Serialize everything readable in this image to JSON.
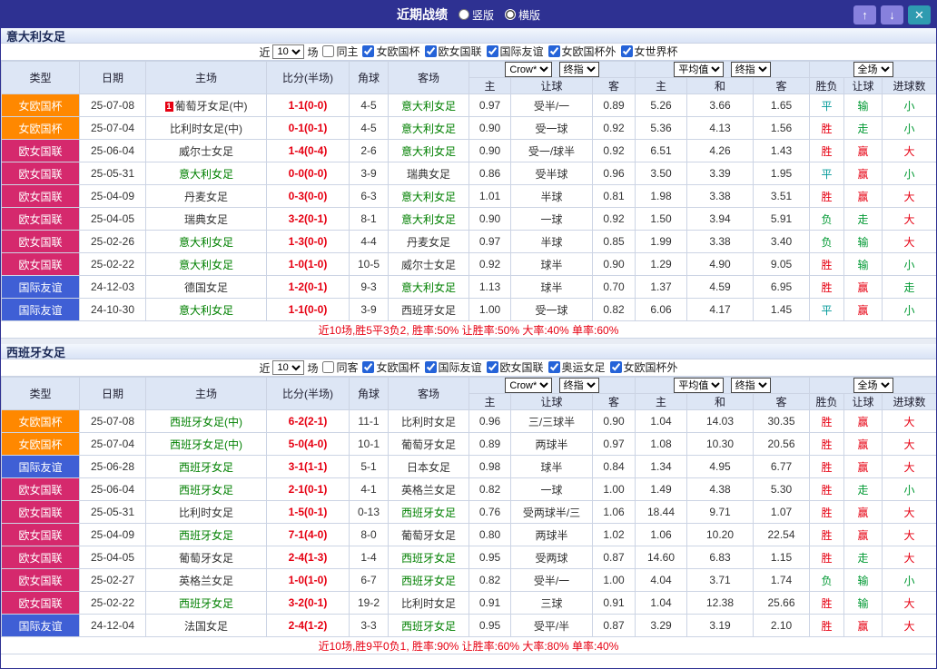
{
  "titlebar": {
    "title": "近期战绩",
    "layout_options": [
      {
        "label": "竖版",
        "checked": false
      },
      {
        "label": "横版",
        "checked": true
      }
    ],
    "buttons": {
      "up": "↑",
      "down": "↓",
      "close": "✕"
    }
  },
  "filter": {
    "prefix": "近",
    "count": "10",
    "suffix": "场"
  },
  "header": {
    "col_type": "类型",
    "col_date": "日期",
    "col_home": "主场",
    "col_score": "比分(半场)",
    "col_corner": "角球",
    "col_away": "客场",
    "dd_company": "Crow*",
    "dd_final": "终指",
    "dd_avg": "平均值",
    "dd_scope": "全场",
    "sub_home": "主",
    "sub_handicap": "让球",
    "sub_away": "客",
    "sub_draw": "和",
    "sub_result": "胜负",
    "sub_goals": "进球数"
  },
  "colors": {
    "league": {
      "女欧国杯": "#ff8800",
      "欧女国联": "#d5296d",
      "国际友谊": "#3f5fd5"
    },
    "result": {
      "win": "#e60012",
      "lose": "#009933",
      "push": "#009999"
    },
    "team_highlight": "#008000",
    "score": "#e60012",
    "summary": "#e60012",
    "accent": "#2e3192"
  },
  "sections": [
    {
      "team": "意大利女足",
      "filters": [
        {
          "label": "同主",
          "checked": false
        },
        {
          "label": "女欧国杯",
          "checked": true
        },
        {
          "label": "欧女国联",
          "checked": true
        },
        {
          "label": "国际友谊",
          "checked": true
        },
        {
          "label": "女欧国杯外",
          "checked": true
        },
        {
          "label": "女世界杯",
          "checked": true
        }
      ],
      "rows": [
        {
          "league": "女欧国杯",
          "date": "25-07-08",
          "home": "葡萄牙女足(中)",
          "mark": "1",
          "score": "1-1(0-0)",
          "corners": "4-5",
          "away": "意大利女足",
          "away_hl": true,
          "handicap_odds": [
            "0.97",
            "受半/一",
            "0.89"
          ],
          "avg_odds": [
            "5.26",
            "3.66",
            "1.65"
          ],
          "results": [
            "平",
            "输",
            "小"
          ]
        },
        {
          "league": "女欧国杯",
          "date": "25-07-04",
          "home": "比利时女足(中)",
          "score": "0-1(0-1)",
          "corners": "4-5",
          "away": "意大利女足",
          "away_hl": true,
          "handicap_odds": [
            "0.90",
            "受一球",
            "0.92"
          ],
          "avg_odds": [
            "5.36",
            "4.13",
            "1.56"
          ],
          "results": [
            "胜",
            "走",
            "小"
          ]
        },
        {
          "league": "欧女国联",
          "date": "25-06-04",
          "home": "威尔士女足",
          "score": "1-4(0-4)",
          "corners": "2-6",
          "away": "意大利女足",
          "away_hl": true,
          "handicap_odds": [
            "0.90",
            "受一/球半",
            "0.92"
          ],
          "avg_odds": [
            "6.51",
            "4.26",
            "1.43"
          ],
          "results": [
            "胜",
            "赢",
            "大"
          ]
        },
        {
          "league": "欧女国联",
          "date": "25-05-31",
          "home": "意大利女足",
          "home_hl": true,
          "score": "0-0(0-0)",
          "corners": "3-9",
          "away": "瑞典女足",
          "handicap_odds": [
            "0.86",
            "受半球",
            "0.96"
          ],
          "avg_odds": [
            "3.50",
            "3.39",
            "1.95"
          ],
          "results": [
            "平",
            "赢",
            "小"
          ]
        },
        {
          "league": "欧女国联",
          "date": "25-04-09",
          "home": "丹麦女足",
          "score": "0-3(0-0)",
          "corners": "6-3",
          "away": "意大利女足",
          "away_hl": true,
          "handicap_odds": [
            "1.01",
            "半球",
            "0.81"
          ],
          "avg_odds": [
            "1.98",
            "3.38",
            "3.51"
          ],
          "results": [
            "胜",
            "赢",
            "大"
          ]
        },
        {
          "league": "欧女国联",
          "date": "25-04-05",
          "home": "瑞典女足",
          "score": "3-2(0-1)",
          "corners": "8-1",
          "away": "意大利女足",
          "away_hl": true,
          "handicap_odds": [
            "0.90",
            "一球",
            "0.92"
          ],
          "avg_odds": [
            "1.50",
            "3.94",
            "5.91"
          ],
          "results": [
            "负",
            "走",
            "大"
          ]
        },
        {
          "league": "欧女国联",
          "date": "25-02-26",
          "home": "意大利女足",
          "home_hl": true,
          "score": "1-3(0-0)",
          "corners": "4-4",
          "away": "丹麦女足",
          "handicap_odds": [
            "0.97",
            "半球",
            "0.85"
          ],
          "avg_odds": [
            "1.99",
            "3.38",
            "3.40"
          ],
          "results": [
            "负",
            "输",
            "大"
          ]
        },
        {
          "league": "欧女国联",
          "date": "25-02-22",
          "home": "意大利女足",
          "home_hl": true,
          "score": "1-0(1-0)",
          "corners": "10-5",
          "away": "威尔士女足",
          "handicap_odds": [
            "0.92",
            "球半",
            "0.90"
          ],
          "avg_odds": [
            "1.29",
            "4.90",
            "9.05"
          ],
          "results": [
            "胜",
            "输",
            "小"
          ]
        },
        {
          "league": "国际友谊",
          "date": "24-12-03",
          "home": "德国女足",
          "score": "1-2(0-1)",
          "corners": "9-3",
          "away": "意大利女足",
          "away_hl": true,
          "handicap_odds": [
            "1.13",
            "球半",
            "0.70"
          ],
          "avg_odds": [
            "1.37",
            "4.59",
            "6.95"
          ],
          "results": [
            "胜",
            "赢",
            "走"
          ]
        },
        {
          "league": "国际友谊",
          "date": "24-10-30",
          "home": "意大利女足",
          "home_hl": true,
          "score": "1-1(0-0)",
          "corners": "3-9",
          "away": "西班牙女足",
          "handicap_odds": [
            "1.00",
            "受一球",
            "0.82"
          ],
          "avg_odds": [
            "6.06",
            "4.17",
            "1.45"
          ],
          "results": [
            "平",
            "赢",
            "小"
          ]
        }
      ],
      "summary": "近10场,胜5平3负2, 胜率:50% 让胜率:50% 大率:40% 单率:60%"
    },
    {
      "team": "西班牙女足",
      "filters": [
        {
          "label": "同客",
          "checked": false
        },
        {
          "label": "女欧国杯",
          "checked": true
        },
        {
          "label": "国际友谊",
          "checked": true
        },
        {
          "label": "欧女国联",
          "checked": true
        },
        {
          "label": "奥运女足",
          "checked": true
        },
        {
          "label": "女欧国杯外",
          "checked": true
        }
      ],
      "rows": [
        {
          "league": "女欧国杯",
          "date": "25-07-08",
          "home": "西班牙女足(中)",
          "home_hl": true,
          "score": "6-2(2-1)",
          "corners": "11-1",
          "away": "比利时女足",
          "handicap_odds": [
            "0.96",
            "三/三球半",
            "0.90"
          ],
          "avg_odds": [
            "1.04",
            "14.03",
            "30.35"
          ],
          "results": [
            "胜",
            "赢",
            "大"
          ]
        },
        {
          "league": "女欧国杯",
          "date": "25-07-04",
          "home": "西班牙女足(中)",
          "home_hl": true,
          "score": "5-0(4-0)",
          "corners": "10-1",
          "away": "葡萄牙女足",
          "handicap_odds": [
            "0.89",
            "两球半",
            "0.97"
          ],
          "avg_odds": [
            "1.08",
            "10.30",
            "20.56"
          ],
          "results": [
            "胜",
            "赢",
            "大"
          ]
        },
        {
          "league": "国际友谊",
          "date": "25-06-28",
          "home": "西班牙女足",
          "home_hl": true,
          "score": "3-1(1-1)",
          "corners": "5-1",
          "away": "日本女足",
          "handicap_odds": [
            "0.98",
            "球半",
            "0.84"
          ],
          "avg_odds": [
            "1.34",
            "4.95",
            "6.77"
          ],
          "results": [
            "胜",
            "赢",
            "大"
          ]
        },
        {
          "league": "欧女国联",
          "date": "25-06-04",
          "home": "西班牙女足",
          "home_hl": true,
          "score": "2-1(0-1)",
          "corners": "4-1",
          "away": "英格兰女足",
          "handicap_odds": [
            "0.82",
            "一球",
            "1.00"
          ],
          "avg_odds": [
            "1.49",
            "4.38",
            "5.30"
          ],
          "results": [
            "胜",
            "走",
            "小"
          ]
        },
        {
          "league": "欧女国联",
          "date": "25-05-31",
          "home": "比利时女足",
          "score": "1-5(0-1)",
          "corners": "0-13",
          "away": "西班牙女足",
          "away_hl": true,
          "handicap_odds": [
            "0.76",
            "受两球半/三",
            "1.06"
          ],
          "avg_odds": [
            "18.44",
            "9.71",
            "1.07"
          ],
          "results": [
            "胜",
            "赢",
            "大"
          ]
        },
        {
          "league": "欧女国联",
          "date": "25-04-09",
          "home": "西班牙女足",
          "home_hl": true,
          "score": "7-1(4-0)",
          "corners": "8-0",
          "away": "葡萄牙女足",
          "handicap_odds": [
            "0.80",
            "两球半",
            "1.02"
          ],
          "avg_odds": [
            "1.06",
            "10.20",
            "22.54"
          ],
          "results": [
            "胜",
            "赢",
            "大"
          ]
        },
        {
          "league": "欧女国联",
          "date": "25-04-05",
          "home": "葡萄牙女足",
          "score": "2-4(1-3)",
          "corners": "1-4",
          "away": "西班牙女足",
          "away_hl": true,
          "handicap_odds": [
            "0.95",
            "受两球",
            "0.87"
          ],
          "avg_odds": [
            "14.60",
            "6.83",
            "1.15"
          ],
          "results": [
            "胜",
            "走",
            "大"
          ]
        },
        {
          "league": "欧女国联",
          "date": "25-02-27",
          "home": "英格兰女足",
          "score": "1-0(1-0)",
          "corners": "6-7",
          "away": "西班牙女足",
          "away_hl": true,
          "handicap_odds": [
            "0.82",
            "受半/一",
            "1.00"
          ],
          "avg_odds": [
            "4.04",
            "3.71",
            "1.74"
          ],
          "results": [
            "负",
            "输",
            "小"
          ]
        },
        {
          "league": "欧女国联",
          "date": "25-02-22",
          "home": "西班牙女足",
          "home_hl": true,
          "score": "3-2(0-1)",
          "corners": "19-2",
          "away": "比利时女足",
          "handicap_odds": [
            "0.91",
            "三球",
            "0.91"
          ],
          "avg_odds": [
            "1.04",
            "12.38",
            "25.66"
          ],
          "results": [
            "胜",
            "输",
            "大"
          ]
        },
        {
          "league": "国际友谊",
          "date": "24-12-04",
          "home": "法国女足",
          "score": "2-4(1-2)",
          "corners": "3-3",
          "away": "西班牙女足",
          "away_hl": true,
          "handicap_odds": [
            "0.95",
            "受平/半",
            "0.87"
          ],
          "avg_odds": [
            "3.29",
            "3.19",
            "2.10"
          ],
          "results": [
            "胜",
            "赢",
            "大"
          ]
        }
      ],
      "summary": "近10场,胜9平0负1, 胜率:90% 让胜率:60% 大率:80% 单率:40%"
    }
  ]
}
